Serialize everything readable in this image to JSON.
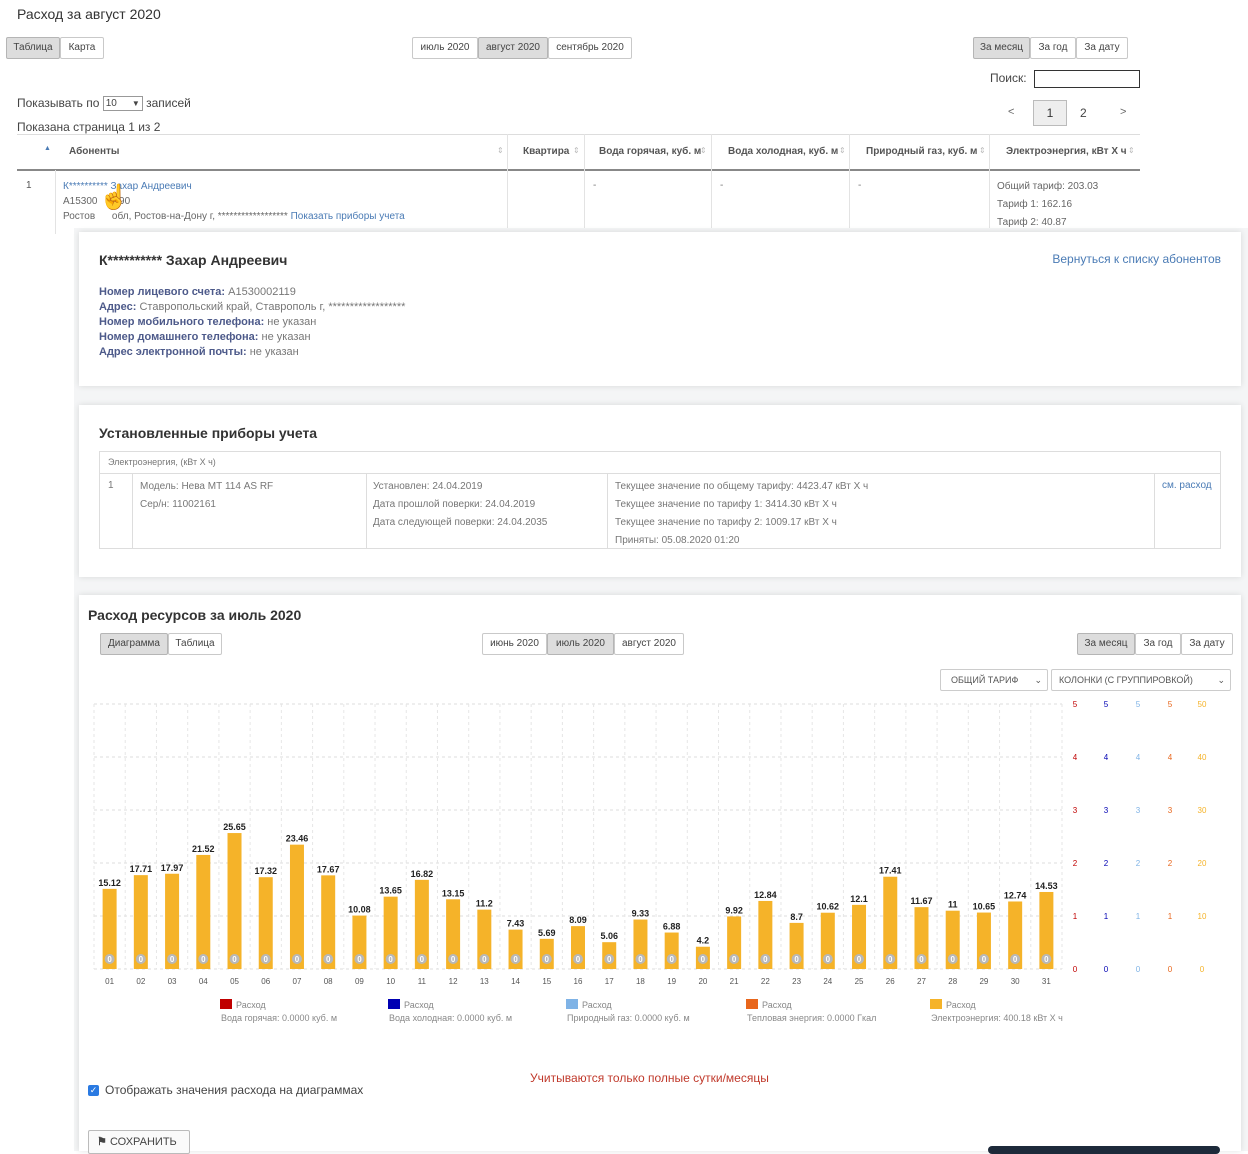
{
  "page_title": "Расход за август 2020",
  "view_tabs": [
    "Таблица",
    "Карта"
  ],
  "month_tabs": [
    "июль 2020",
    "август 2020",
    "сентябрь 2020"
  ],
  "period_tabs": [
    "За месяц",
    "За год",
    "За дату"
  ],
  "search_label": "Поиск:",
  "show_prefix": "Показывать по",
  "show_value": "10",
  "show_suffix": "записей",
  "page_info": "Показана страница 1 из 2",
  "pager": {
    "prev": "<",
    "p1": "1",
    "p2": "2",
    "next": ">"
  },
  "table": {
    "headers": [
      "Абоненты",
      "Квартира",
      "Вода горячая, куб. м",
      "Вода холодная, куб. м",
      "Природный газ, куб. м",
      "Электроэнергия, кВт Х ч"
    ],
    "row": {
      "num": "1",
      "name": "К********** Захар Андреевич",
      "account": "А15300",
      "account_tail": "190",
      "address": "Ростов",
      "address_tail": "обл, Ростов-на-Дону г, ******************",
      "devices_link": "Показать приборы учета",
      "dash": "-",
      "elec": [
        "Общий тариф: 203.03",
        "Тариф 1: 162.16",
        "Тариф 2: 40.87"
      ]
    }
  },
  "profile": {
    "name": "К********** Захар Андреевич",
    "back_link": "Вернуться к списку абонентов",
    "fields": [
      {
        "label": "Номер лицевого счета:",
        "value": "А1530002119"
      },
      {
        "label": "Адрес:",
        "value": "Ставропольский край, Ставрополь г, ******************"
      },
      {
        "label": "Номер мобильного телефона:",
        "value": "не указан"
      },
      {
        "label": "Номер домашнего телефона:",
        "value": "не указан"
      },
      {
        "label": "Адрес электронной почты:",
        "value": "не указан"
      }
    ]
  },
  "devices": {
    "title": "Установленные приборы учета",
    "group": "Электроэнергия, (кВт Х ч)",
    "num": "1",
    "model": "Модель: Нева МТ 114 AS RF",
    "serial": "Сер/н: 11002161",
    "installed": "Установлен: 24.04.2019",
    "prev_check": "Дата прошлой поверки: 24.04.2019",
    "next_check": "Дата следующей поверки: 24.04.2035",
    "cur_total": "Текущее значение по общему тарифу: 4423.47 кВт Х ч",
    "cur_t1": "Текущее значение по тарифу 1: 3414.30 кВт Х ч",
    "cur_t2": "Текущее значение по тарифу 2: 1009.17 кВт Х ч",
    "accepted": "Приняты: 05.08.2020 01:20",
    "see_link": "см. расход"
  },
  "usage": {
    "title": "Расход ресурсов за июль 2020",
    "view_tabs": [
      "Диаграмма",
      "Таблица"
    ],
    "month_tabs": [
      "июнь 2020",
      "июль 2020",
      "август 2020"
    ],
    "period_tabs": [
      "За месяц",
      "За год",
      "За дату"
    ],
    "tariff_select": "ОБЩИЙ ТАРИФ",
    "columns_select": "КОЛОНКИ (С ГРУППИРОВКОЙ)",
    "note": "Учитываются только полные сутки/месяцы",
    "checkbox_label": "Отображать значения расхода на диаграммах",
    "save_button": "СОХРАНИТЬ"
  },
  "chart_data": {
    "type": "bar",
    "categories": [
      "01",
      "02",
      "03",
      "04",
      "05",
      "06",
      "07",
      "08",
      "09",
      "10",
      "11",
      "12",
      "13",
      "14",
      "15",
      "16",
      "17",
      "18",
      "19",
      "20",
      "21",
      "22",
      "23",
      "24",
      "25",
      "26",
      "27",
      "28",
      "29",
      "30",
      "31"
    ],
    "series": [
      {
        "name": "Расход",
        "sub": "Вода горячая: 0.0000 куб. м",
        "color": "#c00000",
        "values": []
      },
      {
        "name": "Расход",
        "sub": "Вода холодная: 0.0000 куб. м",
        "color": "#0000b3",
        "values": []
      },
      {
        "name": "Расход",
        "sub": "Природный газ: 0.0000 куб. м",
        "color": "#7fb3e6",
        "values": []
      },
      {
        "name": "Расход",
        "sub": "Тепловая энергия: 0.0000 Гкал",
        "color": "#e8661c",
        "values": []
      },
      {
        "name": "Расход",
        "sub": "Электроэнергия: 400.18 кВт Х ч",
        "color": "#f5b329",
        "values": [
          15.12,
          17.71,
          17.97,
          21.52,
          25.65,
          17.32,
          23.46,
          17.67,
          10.08,
          13.65,
          16.82,
          13.15,
          11.2,
          7.43,
          5.69,
          8.09,
          5.06,
          9.33,
          6.88,
          4.2,
          9.92,
          12.84,
          8.7,
          10.62,
          12.1,
          17.41,
          11.67,
          11,
          10.65,
          12.74,
          14.53
        ]
      }
    ],
    "zero_labels": "0",
    "right_axes": [
      {
        "color": "#c00000",
        "ticks": [
          "0",
          "1",
          "2",
          "3",
          "4",
          "5"
        ]
      },
      {
        "color": "#0000b3",
        "ticks": [
          "0",
          "1",
          "2",
          "3",
          "4",
          "5"
        ]
      },
      {
        "color": "#7fb3e6",
        "ticks": [
          "0",
          "1",
          "2",
          "3",
          "4",
          "5"
        ]
      },
      {
        "color": "#e8661c",
        "ticks": [
          "0",
          "1",
          "2",
          "3",
          "4",
          "5"
        ]
      },
      {
        "color": "#f5b329",
        "ticks": [
          "0",
          "10",
          "20",
          "30",
          "40",
          "50"
        ]
      }
    ],
    "ylim": [
      0,
      50
    ]
  }
}
